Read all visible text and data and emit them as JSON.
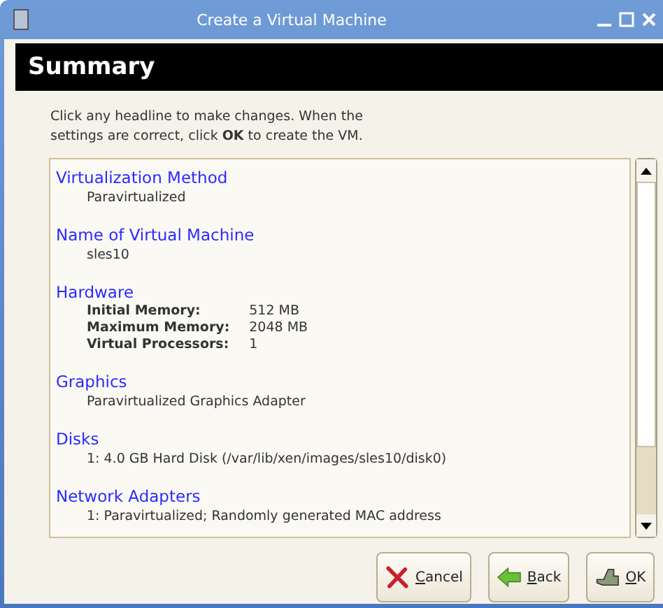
{
  "window": {
    "title": "Create a Virtual Machine"
  },
  "header": {
    "title": "Summary"
  },
  "intro": "Click any headline to make changes.  When the settings are correct, click **OK** to create the VM.",
  "sections": [
    {
      "heading": "Virtualization Method",
      "kind": "text",
      "lines": [
        "Paravirtualized"
      ]
    },
    {
      "heading": "Name of Virtual Machine",
      "kind": "text",
      "lines": [
        "sles10"
      ]
    },
    {
      "heading": "Hardware",
      "kind": "fields",
      "fields": [
        {
          "label": "Initial Memory:",
          "value": "512 MB"
        },
        {
          "label": "Maximum Memory:",
          "value": "2048 MB"
        },
        {
          "label": "Virtual Processors:",
          "value": "1"
        }
      ]
    },
    {
      "heading": "Graphics",
      "kind": "text",
      "lines": [
        "Paravirtualized Graphics Adapter"
      ]
    },
    {
      "heading": "Disks",
      "kind": "text",
      "lines": [
        "1: 4.0 GB Hard Disk (/var/lib/xen/images/sles10/disk0)"
      ]
    },
    {
      "heading": "Network Adapters",
      "kind": "text",
      "lines": [
        "1: Paravirtualized; Randomly generated MAC address"
      ]
    }
  ],
  "buttons": [
    {
      "label": "Cancel",
      "kind": "cancel"
    },
    {
      "label": "Back",
      "kind": "back"
    },
    {
      "label": "OK",
      "kind": "ok"
    }
  ]
}
